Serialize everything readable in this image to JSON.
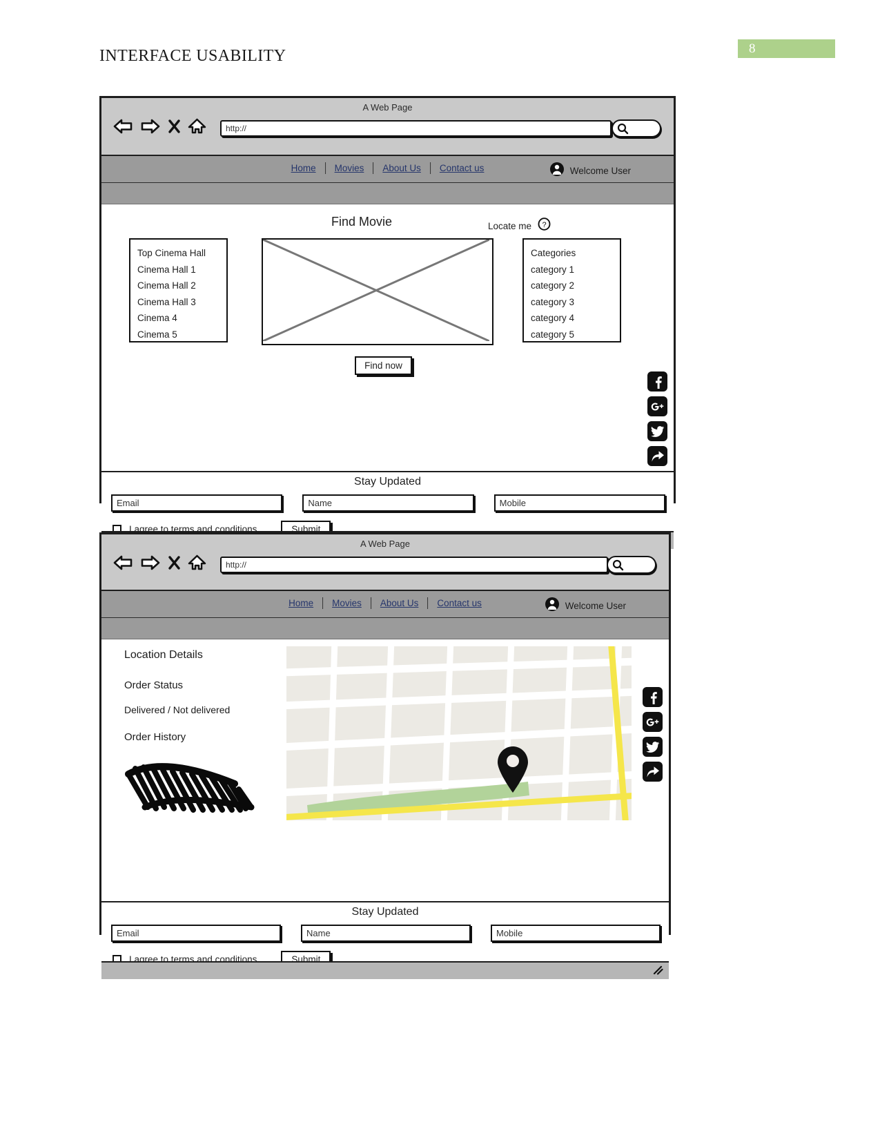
{
  "document": {
    "header_title": "INTERFACE USABILITY",
    "page_number": "8",
    "page_badge_color": "#add18b"
  },
  "browser": {
    "window_title": "A Web Page",
    "url_value": "http://",
    "icons": {
      "back": "back-arrow-icon",
      "forward": "forward-arrow-icon",
      "stop": "close-x-icon",
      "home": "home-icon",
      "search": "magnifier-icon"
    }
  },
  "nav": {
    "links": [
      "Home",
      "Movies",
      "About Us",
      "Contact us"
    ],
    "welcome_text": "Welcome User",
    "avatar_icon": "user-avatar-icon"
  },
  "wireframe1": {
    "find_movie_title": "Find Movie",
    "locate_me_label": "Locate me",
    "locate_me_icon": "help-circle-icon",
    "cinema_panel": {
      "items": [
        "Top Cinema Hall",
        "Cinema Hall 1",
        "Cinema Hall 2",
        "Cinema Hall 3",
        "Cinema 4",
        "Cinema 5"
      ]
    },
    "image_placeholder": "crossed-box-placeholder",
    "categories_panel": {
      "items": [
        "Categories",
        "category 1",
        "category 2",
        "category 3",
        "category 4",
        "category 5"
      ]
    },
    "find_now_label": "Find now"
  },
  "wireframe2": {
    "location_details": "Location Details",
    "order_status": "Order Status",
    "delivery_status": "Delivered / Not delivered",
    "order_history": "Order History",
    "scribble": "hand-drawn-scribble-placeholder",
    "map": {
      "pin_icon": "map-pin-icon",
      "road_color": "#f5e64a",
      "park_color": "#b2d39a",
      "block_color": "#eceae4",
      "street_color": "#ffffff"
    }
  },
  "social": {
    "items": [
      {
        "name": "facebook",
        "glyph": "f"
      },
      {
        "name": "google-plus",
        "glyph": "G+"
      },
      {
        "name": "twitter",
        "glyph": "bird"
      },
      {
        "name": "share",
        "glyph": "arrow"
      }
    ],
    "color": "#101010"
  },
  "footer_form": {
    "heading": "Stay Updated",
    "email_placeholder": "Email",
    "name_placeholder": "Name",
    "mobile_placeholder": "Mobile",
    "terms_label": "I agree to terms and conditions",
    "submit_label": "Submit"
  }
}
